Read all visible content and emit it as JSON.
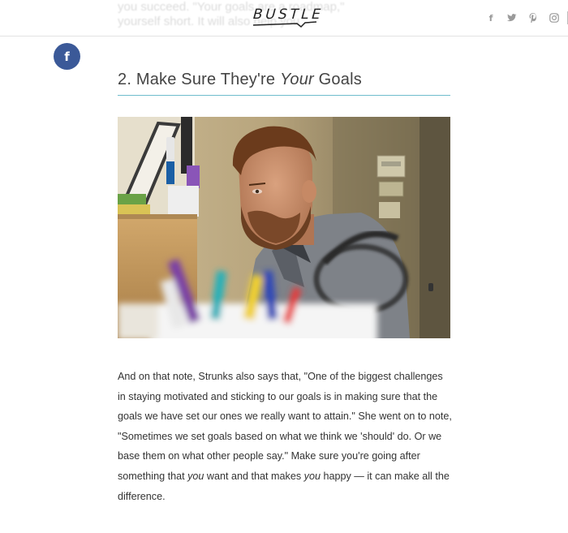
{
  "header": {
    "ghost_line1": "you succeed. \"Your goals are a roadmap,\"",
    "ghost_line2": "yourself short. It will also help you",
    "logo": "BUSTLE",
    "social_icons": [
      "facebook-icon",
      "twitter-icon",
      "pinterest-icon",
      "instagram-icon"
    ],
    "social_glyphs": [
      "f",
      "t",
      "p",
      "◎"
    ]
  },
  "share": {
    "facebook_glyph": "f"
  },
  "article": {
    "heading_prefix": "2. Make Sure They're ",
    "heading_em": "Your",
    "heading_suffix": " Goals",
    "image_description": "Man at desk with blurred markers in foreground",
    "paragraph": {
      "p1": "And on that note, Strunks also says that, \"One of the biggest challenges in staying motivated and sticking to our goals is in making sure that the goals we have set our ones we really want to attain.\" She went on to note, \"Sometimes we set goals based on what we think we 'should' do. Or we base them on what other people say.\" Make sure you're going after something that ",
      "em1": "you",
      "p2": " want and that makes ",
      "em2": "you",
      "p3": " happy — it can make all the difference."
    }
  },
  "colors": {
    "accent_rule": "#6fbdcc",
    "facebook": "#3b5998",
    "text": "#333333"
  }
}
